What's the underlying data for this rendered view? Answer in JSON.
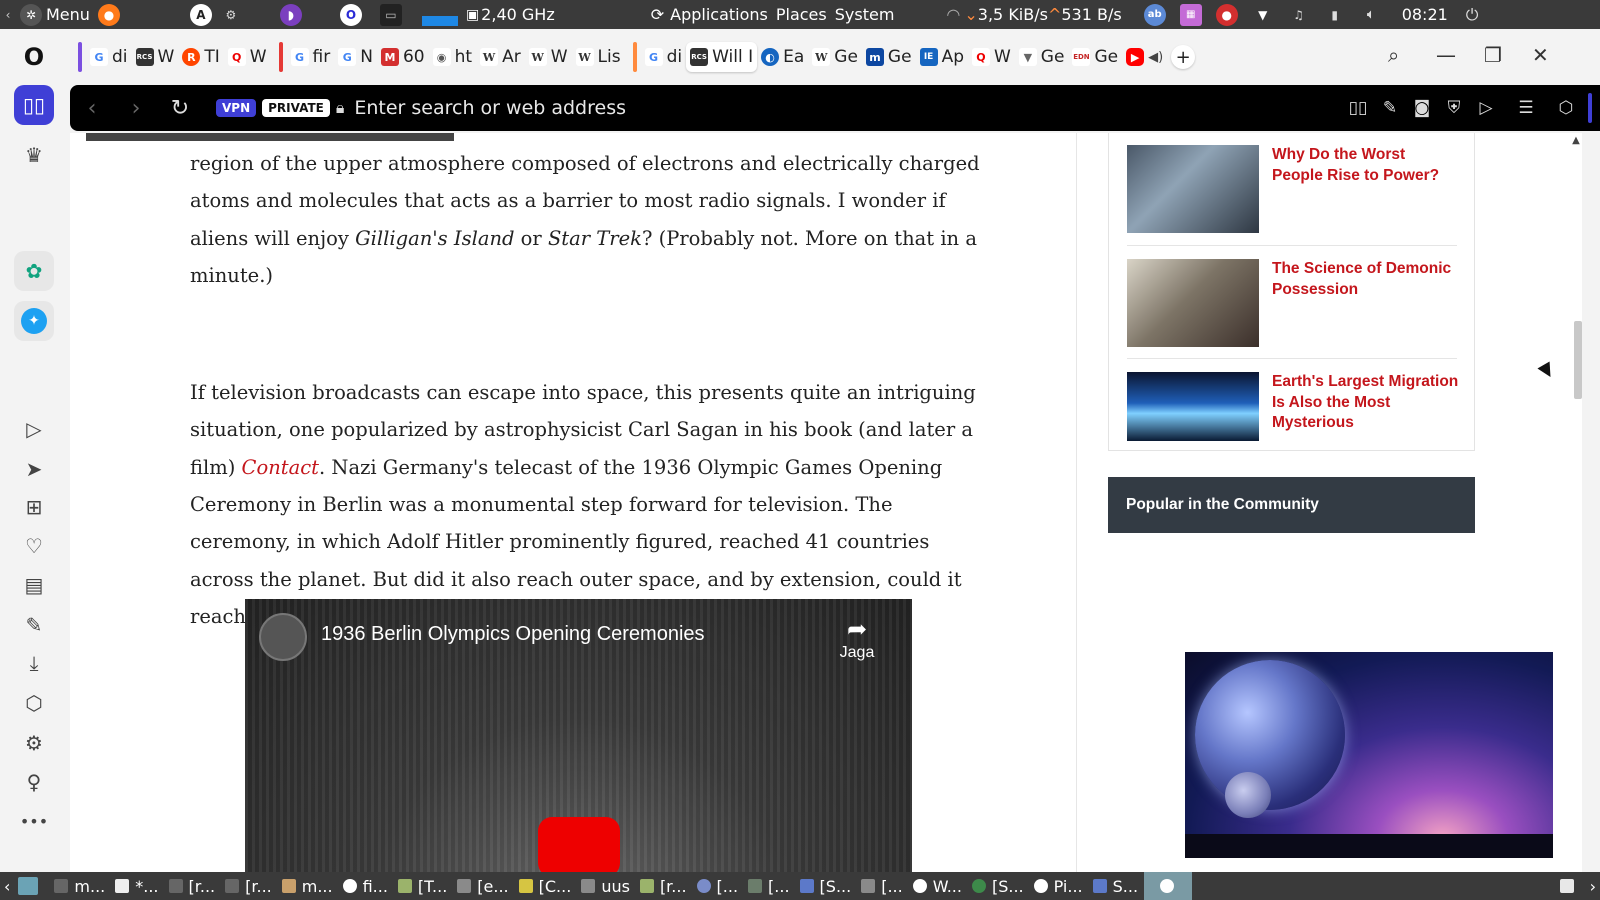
{
  "top_panel": {
    "menu_label": "Menu",
    "cpu_freq": "2,40 GHz",
    "menus": [
      "Applications",
      "Places",
      "System"
    ],
    "net_down": "3,5 KiB/s",
    "net_up": "531 B/s",
    "clock": "08:21"
  },
  "tabs": [
    {
      "label": "di",
      "fav": "G",
      "color": "#4285f4"
    },
    {
      "label": "W",
      "fav": "RCS",
      "color": "#333333"
    },
    {
      "label": "TI",
      "fav": "R",
      "color": "#ff4500"
    },
    {
      "label": "W",
      "fav": "Q",
      "color": "#e00000"
    },
    {
      "label": "fir",
      "fav": "G",
      "color": "#4285f4"
    },
    {
      "label": "N",
      "fav": "G",
      "color": "#4285f4"
    },
    {
      "label": "60",
      "fav": "M",
      "color": "#d32f2f"
    },
    {
      "label": "ht",
      "fav": "◉",
      "color": "#555555"
    },
    {
      "label": "Ar",
      "fav": "W",
      "color": "#444444"
    },
    {
      "label": "W",
      "fav": "W",
      "color": "#444444"
    },
    {
      "label": "Lis",
      "fav": "W",
      "color": "#444444"
    },
    {
      "label": "di",
      "fav": "G",
      "color": "#4285f4"
    },
    {
      "label": "Will I",
      "fav": "RCS",
      "color": "#333333",
      "active": true
    },
    {
      "label": "Ea",
      "fav": "◐",
      "color": "#1565c0"
    },
    {
      "label": "Ge",
      "fav": "W",
      "color": "#444444"
    },
    {
      "label": "Ge",
      "fav": "m",
      "color": "#0d47a1"
    },
    {
      "label": "Ap",
      "fav": "IE",
      "color": "#1565c0"
    },
    {
      "label": "W",
      "fav": "Q",
      "color": "#e00000"
    },
    {
      "label": "Ge",
      "fav": "▼",
      "color": "#666666"
    },
    {
      "label": "Ge",
      "fav": "EDN",
      "color": "#c62828"
    }
  ],
  "address_bar": {
    "vpn_label": "VPN",
    "private_label": "PRIVATE",
    "placeholder": "Enter search or web address"
  },
  "article": {
    "p1_text": "region of the upper atmosphere composed of electrons and electrically charged atoms and molecules that acts as a barrier to most radio signals. I wonder if aliens will enjoy ",
    "p1_em1": "Gilligan's Island",
    "p1_mid": " or ",
    "p1_em2": "Star Trek",
    "p1_end": "? (Probably not. More on that in a minute.)",
    "p2_start": "If television broadcasts can escape into space, this presents quite an intriguing situation, one popularized by astrophysicist Carl Sagan in his book (and later a film) ",
    "p2_link": "Contact",
    "p2_end": ". Nazi Germany's telecast of the 1936 Olympic Games Opening Ceremony in Berlin was a monumental step forward for television. The ceremony, in which Adolf Hitler prominently figured, reached 41 countries across the planet. But did it also reach outer space, and by extension, could it reach aliens?"
  },
  "video": {
    "title": "1936 Berlin Olympics Opening Ceremonies",
    "share_label": "Jaga"
  },
  "related": [
    {
      "title": "Why Do the Worst People Rise to Power?"
    },
    {
      "title": "The Science of Demonic Possession"
    },
    {
      "title": "Earth's Largest Migration Is Also the Most Mysterious"
    }
  ],
  "popular_heading": "Popular in the Community",
  "taskbar": [
    {
      "label": "m...",
      "icon": "terminal"
    },
    {
      "label": "*...",
      "icon": "editor"
    },
    {
      "label": "[r...",
      "icon": "terminal"
    },
    {
      "label": "[r...",
      "icon": "terminal"
    },
    {
      "label": "m...",
      "icon": "app"
    },
    {
      "label": "fi...",
      "icon": "opera"
    },
    {
      "label": "[T...",
      "icon": "app"
    },
    {
      "label": "[e...",
      "icon": "folder"
    },
    {
      "label": "[C...",
      "icon": "app"
    },
    {
      "label": "uus",
      "icon": "folder"
    },
    {
      "label": "[r...",
      "icon": "app"
    },
    {
      "label": "[...",
      "icon": "app"
    },
    {
      "label": "[...",
      "icon": "app"
    },
    {
      "label": "[S...",
      "icon": "app"
    },
    {
      "label": "[...",
      "icon": "folder"
    },
    {
      "label": "W...",
      "icon": "opera"
    },
    {
      "label": "[S...",
      "icon": "app"
    },
    {
      "label": "Pi...",
      "icon": "opera"
    },
    {
      "label": "S...",
      "icon": "app"
    }
  ],
  "colors": {
    "accent_red": "#c4161c",
    "vpn_badge": "#3f3fd6",
    "popular_bg": "#333b44"
  }
}
